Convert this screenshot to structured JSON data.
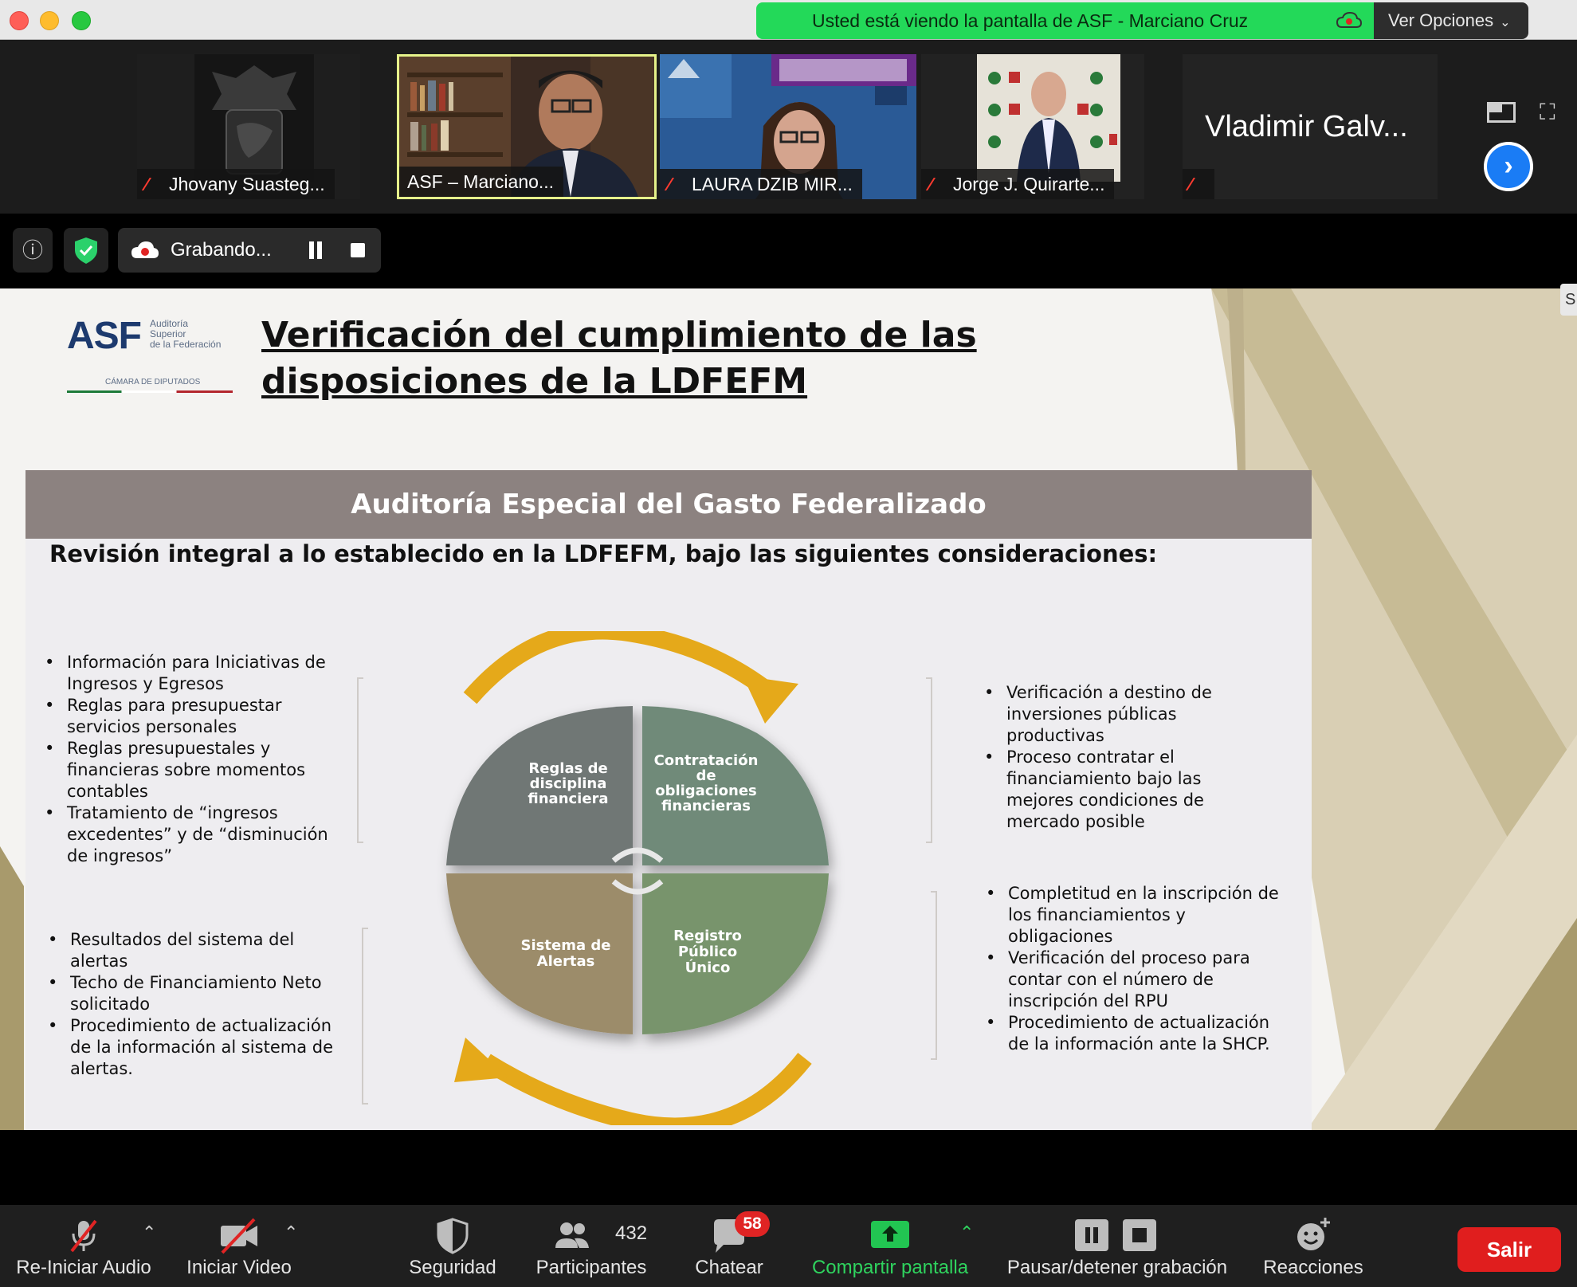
{
  "window": {
    "share_banner": "Usted está viendo la pantalla de ASF - Marciano Cruz",
    "view_options": "Ver Opciones"
  },
  "gallery": {
    "participants": [
      {
        "name": "Jhovany Suasteg..."
      },
      {
        "name": "ASF – Marciano..."
      },
      {
        "name": "LAURA DZIB MIR..."
      },
      {
        "name": "Jorge J. Quirarte..."
      },
      {
        "name": "Vladimir Galv..."
      }
    ]
  },
  "recording": {
    "label": "Grabando..."
  },
  "slide": {
    "logo_text": "ASF",
    "logo_sub": [
      "Auditoría",
      "Superior",
      "de la Federación"
    ],
    "logo_chamber": "CÁMARA DE DIPUTADOS",
    "title": "Verificación del cumplimiento de las disposiciones de la LDFEFM",
    "panel_title": "Auditoría Especial del Gasto Federalizado",
    "subtitle": "Revisión integral a lo establecido en la LDFEFM, bajo las siguientes consideraciones:",
    "list_top_left": [
      "Información para Iniciativas de Ingresos y Egresos",
      "Reglas para presupuestar servicios personales",
      "Reglas presupuestales y financieras sobre momentos contables",
      "Tratamiento de “ingresos excedentes” y de “disminución de ingresos”"
    ],
    "list_bottom_left": [
      "Resultados del sistema del alertas",
      "Techo de Financiamiento Neto solicitado",
      "Procedimiento de actualización de la información al sistema de alertas."
    ],
    "list_top_right": [
      "Verificación a destino de inversiones públicas productivas",
      "Proceso contratar el financiamiento bajo las mejores condiciones de mercado posible"
    ],
    "list_bottom_right": [
      "Completitud en la inscripción de los financiamientos y obligaciones",
      "Verificación del proceso para contar con el número de inscripción del RPU",
      "Procedimiento de actualización de la información ante la SHCP."
    ],
    "quadrants": {
      "tl": [
        "Reglas de",
        "disciplina",
        "financiera"
      ],
      "tr": [
        "Contratación",
        "de",
        "obligaciones",
        "financieras"
      ],
      "bl": [
        "Sistema de",
        "Alertas"
      ],
      "br": [
        "Registro",
        "Público",
        "Único"
      ]
    },
    "colors": {
      "q_tl": "#6f7774",
      "q_tr": "#6f8a79",
      "q_bl": "#9c8c6a",
      "q_br": "#78946c",
      "arrow": "#e5a91a"
    }
  },
  "toolbar": {
    "audio": "Re-Iniciar Audio",
    "video": "Iniciar Video",
    "security": "Seguridad",
    "participants": "Participantes",
    "participants_count": "432",
    "chat": "Chatear",
    "chat_badge": "58",
    "share": "Compartir pantalla",
    "pause_rec": "Pausar/detener grabación",
    "reactions": "Reacciones",
    "leave": "Salir"
  },
  "edge_tab": "S"
}
